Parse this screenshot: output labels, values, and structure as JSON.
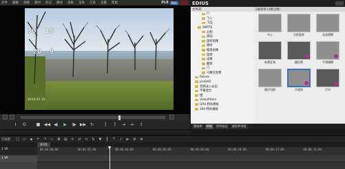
{
  "player": {
    "menu": [
      "文件",
      "编辑",
      "视图",
      "素材",
      "标记",
      "模式",
      "采集",
      "渲染",
      "工具",
      "设置",
      "帮助"
    ],
    "plr_label": "PLR",
    "rec_label": "REC",
    "overlay": {
      "row1_a": "30",
      "row1_b": "15",
      "row2_a": "20",
      "row2_b": "9"
    },
    "date_stamp": "2014.01.22",
    "ruler_hint": "8 10 18",
    "timecodes": [
      {
        "label": "Cur",
        "value": "00:00:05:23"
      },
      {
        "label": "In",
        "value": "00:00:00:00"
      },
      {
        "label": "Out",
        "value": "00:00:54:03"
      },
      {
        "label": "Dur",
        "value": "00:00:54:03"
      },
      {
        "label": "Ttl",
        "value": "00:00:00:00"
      }
    ],
    "scrub_position": 0.68
  },
  "bin": {
    "app_name": "EDIUS",
    "tree_header": "文件夹",
    "tree_items": [
      {
        "label": "门",
        "selected": false
      },
      {
        "label": "飞入",
        "selected": false
      },
      {
        "label": "飞出",
        "selected": false
      },
      {
        "label": "SMPTE",
        "selected": false
      },
      {
        "label": "分割",
        "selected": false
      },
      {
        "label": "滑动",
        "selected": false
      },
      {
        "label": "旋转划像",
        "selected": false
      },
      {
        "label": "擦除",
        "selected": false
      },
      {
        "label": "缩放划像",
        "selected": false
      },
      {
        "label": "旋转",
        "selected": false
      },
      {
        "label": "边缘",
        "selected": false
      },
      {
        "label": "翻转",
        "selected": false
      },
      {
        "label": "门",
        "selected": false
      },
      {
        "label": "马赛克划像",
        "selected": false
      },
      {
        "label": "Rotate",
        "selected": false
      },
      {
        "label": "proDAD",
        "selected": false
      },
      {
        "label": "音频淡入淡出",
        "selected": false
      },
      {
        "label": "字幕混合",
        "selected": false
      },
      {
        "label": "键",
        "selected": false
      },
      {
        "label": "Videofilters",
        "selected": false
      },
      {
        "label": "GPU-特效模板",
        "selected": false
      },
      {
        "label": "360-特效模板",
        "selected": false
      }
    ],
    "thumb_header": "2维转场 (4维过渡)",
    "thumbs": [
      {
        "caption": "中心",
        "dark": false,
        "dot": false,
        "selected": false
      },
      {
        "caption": "方框旋转",
        "dark": false,
        "dot": false,
        "selected": false
      },
      {
        "caption": "动态模糊",
        "dark": false,
        "dot": false,
        "selected": false
      },
      {
        "caption": "新建区域",
        "dark": true,
        "dot": false,
        "selected": false
      },
      {
        "caption": "圆形擦",
        "dark": true,
        "dot": true,
        "selected": false
      },
      {
        "caption": "平滑模糊",
        "dark": false,
        "dot": true,
        "selected": false
      },
      {
        "caption": "循环切换",
        "dark": false,
        "dot": false,
        "selected": false
      },
      {
        "caption": "不规则",
        "dark": false,
        "dot": true,
        "selected": true
      },
      {
        "caption": "打印",
        "dark": true,
        "dot": true,
        "selected": false
      }
    ],
    "tabs": [
      {
        "label": "素材库",
        "active": false
      },
      {
        "label": "特效",
        "active": true
      },
      {
        "label": "序列标记",
        "active": false
      },
      {
        "label": "源文件浏览",
        "active": false
      }
    ]
  },
  "timeline": {
    "mode_label": "无标题",
    "sequence_tab": "序列1",
    "ruler_head": "1 VA",
    "track_label": "1 VA",
    "ticks": [
      "00:00:00:00",
      "00:00:02:00",
      "00:00:04:00",
      "00:00:06:00",
      "00:00:08:00",
      "00:00:10:00",
      "00:00:12:00",
      "00:00:14:00"
    ],
    "cursor_position": 0.23
  }
}
